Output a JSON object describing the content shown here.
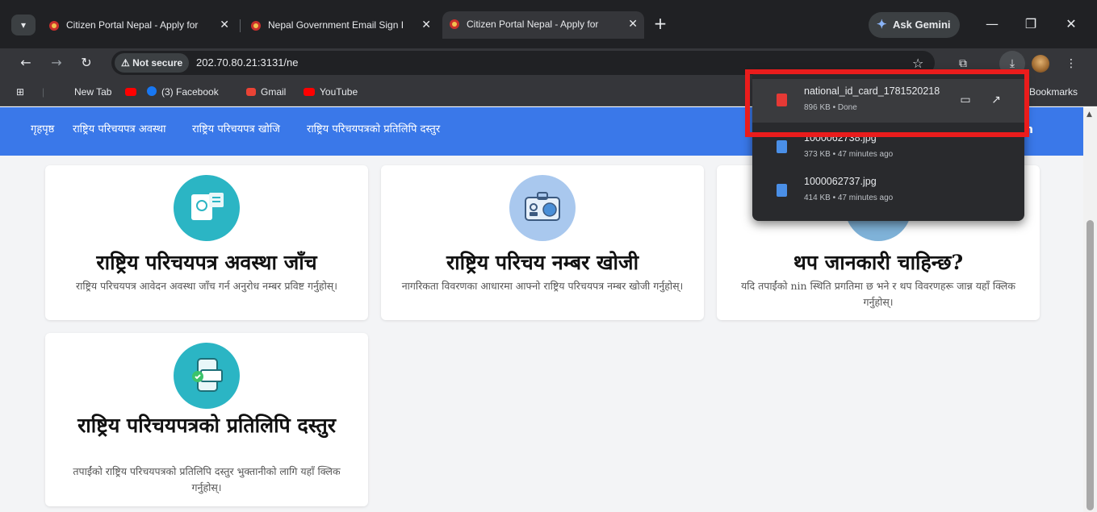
{
  "browser": {
    "tabs": [
      {
        "title": "Citizen Portal Nepal - Apply for",
        "active": false
      },
      {
        "title": "Nepal Government Email Sign I",
        "active": false
      },
      {
        "title": "Citizen Portal Nepal - Apply for",
        "active": true
      }
    ],
    "gemini_label": "Ask Gemini",
    "not_secure_label": "Not secure",
    "url": "202.70.80.21:3131/ne",
    "bookmarks": [
      "New Tab",
      "(3) Facebook",
      "Gmail",
      "YouTube"
    ],
    "bookmarks_right": "Bookmarks",
    "icons": {
      "back": "back-arrow-icon",
      "forward": "forward-arrow-icon",
      "reload": "reload-icon",
      "star": "bookmark-star-icon",
      "download": "download-icon"
    }
  },
  "downloads": [
    {
      "name": "national_id_card_1781520218",
      "meta": "896 KB • Done",
      "type": "pdf"
    },
    {
      "name": "1000062738.jpg",
      "meta": "373 KB • 47 minutes ago",
      "type": "image"
    },
    {
      "name": "1000062737.jpg",
      "meta": "414 KB • 47 minutes ago",
      "type": "image"
    }
  ],
  "site": {
    "nav": [
      "गृहपृष्ठ",
      "राष्ट्रिय परिचयपत्र अवस्था",
      "राष्ट्रिय परिचयपत्र खोजि",
      "राष्ट्रिय परिचयपत्रको प्रतिलिपि दस्तुर"
    ],
    "nav_right": "n",
    "cards": [
      {
        "title": "राष्ट्रिय परिचयपत्र अवस्था जाँच",
        "desc": "राष्ट्रिय परिचयपत्र आवेदन अवस्था जाँच गर्न अनुरोध नम्बर प्रविष्ट गर्नुहोस्।",
        "icon_color": "#2bb5c4"
      },
      {
        "title": "राष्ट्रिय परिचय नम्बर खोजी",
        "desc": "नागरिकता विवरणका आधारमा आफ्नो राष्ट्रिय परिचयपत्र नम्बर खोजी गर्नुहोस्।",
        "icon_color": "#a9c8ee"
      },
      {
        "title": "थप जानकारी चाहिन्छ?",
        "desc": "यदि तपाईंको nin स्थिति प्रगतिमा छ भने र थप विवरणहरू जान्न यहाँ क्लिक गर्नुहोस्।",
        "icon_color": "#7fb2d8"
      },
      {
        "title": "राष्ट्रिय परिचयपत्रको प्रतिलिपि दस्तुर",
        "desc": "तपाईंको राष्ट्रिय परिचयपत्रको प्रतिलिपि दस्तुर भुक्तानीको लागि यहाँ क्लिक गर्नुहोस्।",
        "icon_color": "#2bb5c4"
      }
    ]
  },
  "colors": {
    "chrome_dark": "#202124",
    "site_blue": "#3a78e9",
    "highlight_red": "#ea1c1c"
  }
}
